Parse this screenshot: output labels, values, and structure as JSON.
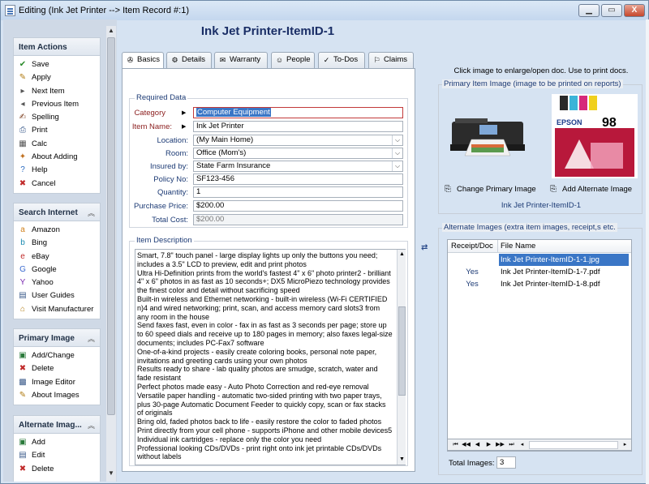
{
  "window": {
    "title": "Editing  (Ink Jet Printer --> Item Record #:1)",
    "buttons": {
      "minimize": "▁",
      "maximize": "▭",
      "close": "X"
    }
  },
  "sidebar": {
    "item_actions": {
      "title": "Item Actions",
      "items": [
        {
          "label": "Save",
          "icon": "✔",
          "color": "#2a8a2a"
        },
        {
          "label": "Apply",
          "icon": "✎",
          "color": "#b07a10"
        },
        {
          "label": "Next Item",
          "icon": "▸",
          "color": "#555555"
        },
        {
          "label": "Previous Item",
          "icon": "◂",
          "color": "#555555"
        },
        {
          "label": "Spelling",
          "icon": "✍",
          "color": "#7a3a1a"
        },
        {
          "label": "Print",
          "icon": "⎙",
          "color": "#3a5a8a"
        },
        {
          "label": "Calc",
          "icon": "▦",
          "color": "#555555"
        },
        {
          "label": "About Adding",
          "icon": "✦",
          "color": "#c07020"
        },
        {
          "label": "Help",
          "icon": "?",
          "color": "#2a6ac0"
        },
        {
          "label": "Cancel",
          "icon": "✖",
          "color": "#c02a2a"
        }
      ]
    },
    "search_internet": {
      "title": "Search Internet",
      "items": [
        {
          "label": "Amazon",
          "icon": "a",
          "color": "#d0801a"
        },
        {
          "label": "Bing",
          "icon": "b",
          "color": "#1a8ab0"
        },
        {
          "label": "eBay",
          "icon": "e",
          "color": "#c02a2a"
        },
        {
          "label": "Google",
          "icon": "G",
          "color": "#3a6ad0"
        },
        {
          "label": "Yahoo",
          "icon": "Y",
          "color": "#7a2ab0"
        },
        {
          "label": "User Guides",
          "icon": "▤",
          "color": "#3a5a8a"
        },
        {
          "label": "Visit Manufacturer",
          "icon": "⌂",
          "color": "#b07a10"
        }
      ]
    },
    "primary_image": {
      "title": "Primary Image",
      "items": [
        {
          "label": "Add/Change",
          "icon": "▣",
          "color": "#2a7a3a"
        },
        {
          "label": "Delete",
          "icon": "✖",
          "color": "#c02a2a"
        },
        {
          "label": "Image Editor",
          "icon": "▩",
          "color": "#3a5a8a"
        },
        {
          "label": "About Images",
          "icon": "✎",
          "color": "#b07a10"
        }
      ]
    },
    "alternate_images": {
      "title": "Alternate Imag...",
      "items": [
        {
          "label": "Add",
          "icon": "▣",
          "color": "#2a7a3a"
        },
        {
          "label": "Edit",
          "icon": "▤",
          "color": "#3a5a8a"
        },
        {
          "label": "Delete",
          "icon": "✖",
          "color": "#c02a2a"
        }
      ]
    }
  },
  "main": {
    "title": "Ink Jet Printer-ItemID-1",
    "tabs": [
      {
        "label": "Basics",
        "icon": "✇",
        "active": true
      },
      {
        "label": "Details",
        "icon": "⚙"
      },
      {
        "label": "Warranty",
        "icon": "✉"
      },
      {
        "label": "People",
        "icon": "☺"
      },
      {
        "label": "To-Dos",
        "icon": "✓"
      },
      {
        "label": "Claims",
        "icon": "⚐"
      }
    ],
    "required_data": {
      "title": "Required Data",
      "category": {
        "label": "Category",
        "value": "Computer Equipment"
      },
      "item_name": {
        "label": "Item Name:",
        "value": "Ink Jet Printer"
      },
      "location": {
        "label": "Location:",
        "value": "(My Main Home)"
      },
      "room": {
        "label": "Room:",
        "value": "Office (Mom's)"
      },
      "insured_by": {
        "label": "Insured by:",
        "value": "State Farm Insurance"
      },
      "policy_no": {
        "label": "Policy No:",
        "value": "SF123-456"
      },
      "quantity": {
        "label": "Quantity:",
        "value": "1"
      },
      "purchase_price": {
        "label": "Purchase Price:",
        "value": "$200.00"
      },
      "total_cost": {
        "label": "Total Cost:",
        "value": "$200.00"
      }
    },
    "item_description": {
      "title": "Item Description",
      "text": "Smart, 7.8\" touch panel - large display lights up only the buttons you need; includes a 3.5\" LCD to preview, edit and print photos\nUltra Hi-Definition prints from the world's fastest 4\" x 6\" photo printer2 - brilliant 4\" x 6\" photos in as fast as 10 seconds+; DX5 MicroPiezo technology provides the finest color and detail without sacrificing speed\nBuilt-in wireless and Ethernet networking - built-in wireless (Wi-Fi CERTIFIED n)4 and wired networking; print, scan, and access memory card slots3 from any room in the house\nSend faxes fast, even in color - fax in as fast as 3 seconds per page; store up to 60 speed dials and receive up to 180 pages in memory; also faxes legal-size documents; includes PC-Fax7 software\nOne-of-a-kind projects - easily create coloring books, personal note paper, invitations and greeting cards using your own photos\nResults ready to share - lab quality photos are smudge, scratch, water and fade resistant\nPerfect photos made easy - Auto Photo Correction and red-eye removal\nVersatile paper handling - automatic two-sided printing with two paper trays, plus 30-page Automatic Document Feeder to quickly copy, scan or fax stacks of originals\nBring old, faded photos back to life - easily restore the color to faded photos\nPrint directly from your cell phone - supports iPhone and other mobile devices5\nIndividual ink cartridges - replace only the color you need\nProfessional looking CDs/DVDs - print right onto ink jet printable CDs/DVDs without labels"
    }
  },
  "right_panel": {
    "info": "Click image to enlarge/open doc. Use to print docs.",
    "primary_group_title": "Primary Item Image (image to be printed on reports)",
    "change_primary_label": "Change Primary Image",
    "add_alternate_label": "Add Alternate Image",
    "primary_caption": "Ink Jet Printer-ItemID-1",
    "product_brand": "EPSON",
    "product_number": "98",
    "alternate_group_title": "Alternate Images (extra item images, receipt,s etc.",
    "grid": {
      "col_receipt": "Receipt/Doc",
      "col_file": "File Name",
      "rows": [
        {
          "receipt": "",
          "file": "Ink Jet Printer-ItemID-1-1.jpg",
          "selected": true
        },
        {
          "receipt": "Yes",
          "file": "Ink Jet Printer-ItemID-1-7.pdf"
        },
        {
          "receipt": "Yes",
          "file": "Ink Jet Printer-ItemID-1-8.pdf"
        }
      ]
    },
    "total_images_label": "Total Images:",
    "total_images_value": "3"
  }
}
